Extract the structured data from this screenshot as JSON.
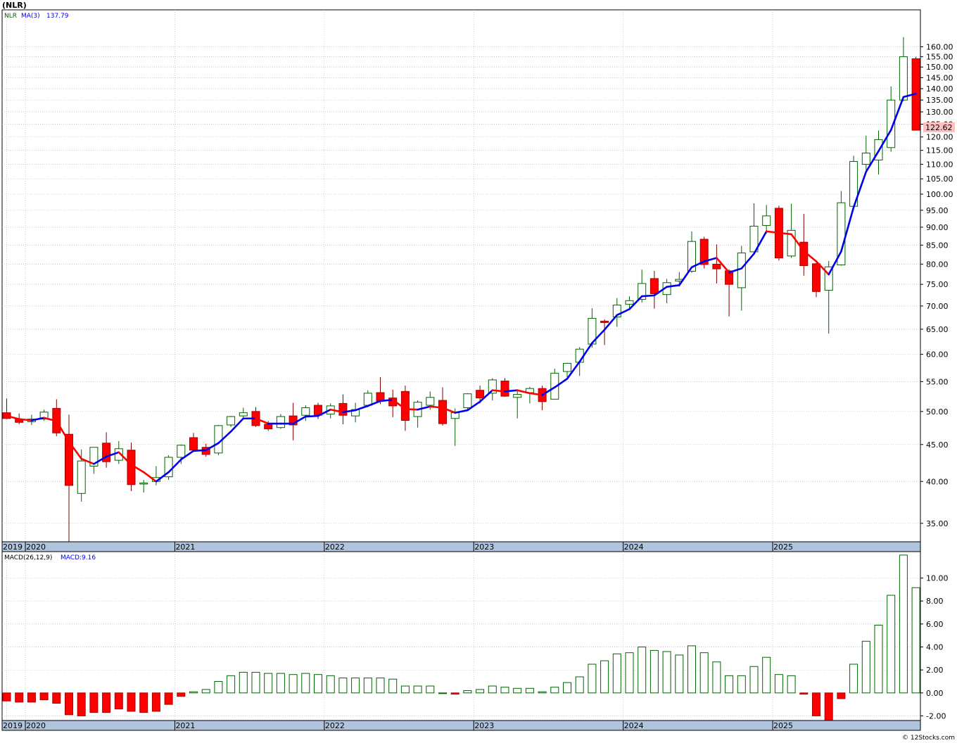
{
  "title": "(NLR)",
  "watermark": "© 12Stocks.com",
  "colors": {
    "up": "#006400",
    "down": "#ff0000",
    "ma_up": "#0000ee",
    "ma_down": "#ff0000",
    "price_badge_bg": "#ffc0c0",
    "axis_band": "#b0c4de",
    "grid": "#bbbbbb"
  },
  "chart_data": [
    {
      "type": "candlestick",
      "panel": "price",
      "legend": {
        "symbol": "NLR",
        "ma_label": "MA(3)",
        "ma_value": "137.79"
      },
      "last_price": "122.62",
      "y_scale": "log",
      "ylim": [
        33,
        180
      ],
      "y_ticks": [
        "35.00",
        "40.00",
        "45.00",
        "50.00",
        "55.00",
        "60.00",
        "65.00",
        "70.00",
        "75.00",
        "80.00",
        "85.00",
        "90.00",
        "95.00",
        "100.00",
        "105.00",
        "110.00",
        "115.00",
        "120.00",
        "125.00",
        "130.00",
        "135.00",
        "140.00",
        "145.00",
        "150.00",
        "155.00",
        "160.00"
      ],
      "x_ticks": [
        "2019",
        "2020",
        "2021",
        "2022",
        "2023",
        "2024",
        "2025"
      ],
      "grid": true,
      "candles": [
        {
          "o": 49.8,
          "h": 52.1,
          "l": 48.8,
          "c": 48.9
        },
        {
          "o": 48.8,
          "h": 49.7,
          "l": 48.0,
          "c": 48.3
        },
        {
          "o": 48.4,
          "h": 49.5,
          "l": 47.9,
          "c": 48.8
        },
        {
          "o": 48.8,
          "h": 50.3,
          "l": 48.5,
          "c": 49.9
        },
        {
          "o": 50.5,
          "h": 52.0,
          "l": 46.2,
          "c": 46.7
        },
        {
          "o": 46.5,
          "h": 49.5,
          "l": 33.0,
          "c": 39.5
        },
        {
          "o": 38.5,
          "h": 44.3,
          "l": 37.5,
          "c": 42.7
        },
        {
          "o": 42.0,
          "h": 44.5,
          "l": 41.0,
          "c": 44.6
        },
        {
          "o": 45.2,
          "h": 46.8,
          "l": 41.8,
          "c": 42.6
        },
        {
          "o": 42.8,
          "h": 45.5,
          "l": 42.3,
          "c": 44.4
        },
        {
          "o": 44.2,
          "h": 45.3,
          "l": 38.8,
          "c": 39.6
        },
        {
          "o": 39.7,
          "h": 40.2,
          "l": 38.6,
          "c": 39.8
        },
        {
          "o": 40.0,
          "h": 42.0,
          "l": 39.5,
          "c": 40.5
        },
        {
          "o": 40.6,
          "h": 43.5,
          "l": 40.2,
          "c": 43.2
        },
        {
          "o": 43.2,
          "h": 45.0,
          "l": 42.3,
          "c": 44.9
        },
        {
          "o": 46.0,
          "h": 46.7,
          "l": 44.0,
          "c": 44.2
        },
        {
          "o": 44.6,
          "h": 45.1,
          "l": 43.3,
          "c": 43.6
        },
        {
          "o": 43.8,
          "h": 47.9,
          "l": 43.5,
          "c": 47.8
        },
        {
          "o": 47.9,
          "h": 49.3,
          "l": 47.6,
          "c": 49.2
        },
        {
          "o": 49.3,
          "h": 50.6,
          "l": 48.8,
          "c": 49.8
        },
        {
          "o": 50.0,
          "h": 50.7,
          "l": 47.6,
          "c": 47.8
        },
        {
          "o": 48.0,
          "h": 48.5,
          "l": 47.0,
          "c": 47.3
        },
        {
          "o": 47.5,
          "h": 49.6,
          "l": 47.3,
          "c": 49.2
        },
        {
          "o": 49.3,
          "h": 51.4,
          "l": 45.6,
          "c": 47.9
        },
        {
          "o": 49.4,
          "h": 51.0,
          "l": 48.5,
          "c": 50.6
        },
        {
          "o": 51.0,
          "h": 51.4,
          "l": 48.8,
          "c": 49.4
        },
        {
          "o": 49.6,
          "h": 51.3,
          "l": 48.9,
          "c": 50.9
        },
        {
          "o": 51.3,
          "h": 52.8,
          "l": 48.0,
          "c": 49.4
        },
        {
          "o": 49.3,
          "h": 51.4,
          "l": 48.3,
          "c": 50.3
        },
        {
          "o": 51.0,
          "h": 53.5,
          "l": 50.7,
          "c": 53.0
        },
        {
          "o": 53.1,
          "h": 55.8,
          "l": 51.2,
          "c": 51.7
        },
        {
          "o": 52.2,
          "h": 53.6,
          "l": 49.1,
          "c": 50.9
        },
        {
          "o": 53.3,
          "h": 54.3,
          "l": 47.0,
          "c": 48.6
        },
        {
          "o": 49.2,
          "h": 51.8,
          "l": 47.5,
          "c": 51.5
        },
        {
          "o": 51.0,
          "h": 53.3,
          "l": 50.3,
          "c": 52.3
        },
        {
          "o": 51.8,
          "h": 54.0,
          "l": 47.8,
          "c": 48.1
        },
        {
          "o": 48.9,
          "h": 50.5,
          "l": 44.8,
          "c": 49.8
        },
        {
          "o": 50.6,
          "h": 53.0,
          "l": 50.3,
          "c": 52.9
        },
        {
          "o": 53.5,
          "h": 54.3,
          "l": 51.3,
          "c": 52.2
        },
        {
          "o": 53.0,
          "h": 55.6,
          "l": 51.8,
          "c": 55.3
        },
        {
          "o": 55.1,
          "h": 55.6,
          "l": 52.4,
          "c": 52.5
        },
        {
          "o": 52.3,
          "h": 53.5,
          "l": 48.9,
          "c": 52.8
        },
        {
          "o": 53.1,
          "h": 54.1,
          "l": 51.3,
          "c": 53.8
        },
        {
          "o": 53.8,
          "h": 54.3,
          "l": 50.2,
          "c": 51.6
        },
        {
          "o": 52.0,
          "h": 57.3,
          "l": 52.0,
          "c": 56.5
        },
        {
          "o": 56.8,
          "h": 58.4,
          "l": 55.8,
          "c": 58.3
        },
        {
          "o": 58.5,
          "h": 61.4,
          "l": 56.0,
          "c": 61.0
        },
        {
          "o": 62.0,
          "h": 69.5,
          "l": 61.3,
          "c": 67.3
        },
        {
          "o": 66.7,
          "h": 67.1,
          "l": 61.8,
          "c": 66.4
        },
        {
          "o": 67.6,
          "h": 71.8,
          "l": 65.5,
          "c": 70.2
        },
        {
          "o": 70.4,
          "h": 72.2,
          "l": 69.4,
          "c": 71.2
        },
        {
          "o": 71.5,
          "h": 78.6,
          "l": 70.8,
          "c": 75.2
        },
        {
          "o": 76.4,
          "h": 78.3,
          "l": 69.4,
          "c": 72.8
        },
        {
          "o": 72.6,
          "h": 76.3,
          "l": 70.6,
          "c": 75.4
        },
        {
          "o": 75.8,
          "h": 78.0,
          "l": 74.5,
          "c": 76.2
        },
        {
          "o": 78.2,
          "h": 88.8,
          "l": 77.8,
          "c": 86.0
        },
        {
          "o": 86.6,
          "h": 87.3,
          "l": 78.9,
          "c": 79.9
        },
        {
          "o": 80.0,
          "h": 85.2,
          "l": 75.2,
          "c": 78.8
        },
        {
          "o": 78.3,
          "h": 78.7,
          "l": 67.7,
          "c": 75.0
        },
        {
          "o": 74.2,
          "h": 84.8,
          "l": 69.0,
          "c": 82.9
        },
        {
          "o": 83.2,
          "h": 97.1,
          "l": 82.5,
          "c": 90.3
        },
        {
          "o": 90.5,
          "h": 96.6,
          "l": 88.2,
          "c": 93.3
        },
        {
          "o": 95.6,
          "h": 96.4,
          "l": 80.9,
          "c": 81.6
        },
        {
          "o": 82.1,
          "h": 97.0,
          "l": 81.6,
          "c": 89.1
        },
        {
          "o": 85.8,
          "h": 93.9,
          "l": 77.1,
          "c": 79.6
        },
        {
          "o": 80.1,
          "h": 80.3,
          "l": 72.0,
          "c": 73.3
        },
        {
          "o": 73.6,
          "h": 80.8,
          "l": 64.1,
          "c": 79.3
        },
        {
          "o": 79.8,
          "h": 101.0,
          "l": 79.6,
          "c": 97.3
        },
        {
          "o": 96.2,
          "h": 113.0,
          "l": 95.9,
          "c": 111.0
        },
        {
          "o": 110.0,
          "h": 120.5,
          "l": 108.0,
          "c": 114.0
        },
        {
          "o": 111.5,
          "h": 122.5,
          "l": 106.5,
          "c": 119.0
        },
        {
          "o": 116.0,
          "h": 141.0,
          "l": 114.5,
          "c": 135.0
        },
        {
          "o": 135.0,
          "h": 165.0,
          "l": 134.5,
          "c": 155.0
        },
        {
          "o": 154.0,
          "h": 155.0,
          "l": 122.6,
          "c": 122.62
        }
      ],
      "ma3": [
        49.3,
        48.8,
        48.6,
        49.0,
        48.5,
        45.4,
        43.0,
        42.3,
        43.3,
        43.9,
        42.2,
        41.2,
        40.0,
        41.2,
        42.9,
        44.1,
        44.2,
        45.2,
        46.9,
        48.9,
        48.9,
        48.1,
        48.1,
        48.1,
        49.2,
        49.3,
        50.3,
        49.9,
        50.2,
        50.9,
        51.7,
        51.9,
        50.4,
        50.3,
        50.8,
        50.6,
        49.8,
        50.2,
        51.6,
        53.5,
        53.3,
        53.5,
        53.0,
        52.7,
        54.0,
        55.5,
        58.6,
        62.2,
        64.9,
        68.0,
        69.3,
        72.2,
        72.4,
        74.4,
        74.8,
        79.2,
        80.7,
        81.6,
        77.9,
        78.9,
        82.7,
        88.8,
        88.4,
        88.0,
        83.4,
        80.7,
        77.4,
        83.3,
        95.9,
        107.4,
        114.7,
        122.7,
        136.3,
        137.79
      ],
      "x_tick_index": [
        0,
        1.5,
        13.5,
        25.5,
        37.5,
        49.5,
        61.5
      ]
    },
    {
      "type": "bar",
      "panel": "macd",
      "legend": {
        "label": "MACD(26,12,9)",
        "value_label": "MACD:9.16"
      },
      "ylim": [
        -2.4,
        12.3
      ],
      "y_ticks": [
        "-2.00",
        "0.00",
        "2.00",
        "4.00",
        "6.00",
        "8.00",
        "10.00"
      ],
      "y_tick_values": [
        -2,
        0,
        2,
        4,
        6,
        8,
        10
      ],
      "x_ticks": [
        "2019",
        "2020",
        "2021",
        "2022",
        "2023",
        "2024",
        "2025"
      ],
      "values": [
        -0.7,
        -0.8,
        -0.8,
        -0.6,
        -0.9,
        -1.9,
        -2.0,
        -1.7,
        -1.7,
        -1.4,
        -1.6,
        -1.7,
        -1.6,
        -1.0,
        -0.3,
        0.1,
        0.3,
        1.0,
        1.5,
        1.8,
        1.8,
        1.7,
        1.7,
        1.6,
        1.7,
        1.6,
        1.5,
        1.3,
        1.3,
        1.3,
        1.3,
        1.2,
        0.6,
        0.6,
        0.6,
        0.0,
        -0.1,
        0.2,
        0.3,
        0.6,
        0.5,
        0.4,
        0.4,
        0.1,
        0.5,
        0.9,
        1.4,
        2.5,
        2.8,
        3.4,
        3.5,
        4.0,
        3.7,
        3.6,
        3.3,
        4.1,
        3.5,
        2.7,
        1.5,
        1.5,
        2.3,
        3.1,
        1.6,
        1.5,
        -0.1,
        -2.0,
        -2.5,
        -0.5,
        2.5,
        4.5,
        5.9,
        8.5,
        12.0,
        9.16
      ]
    }
  ]
}
